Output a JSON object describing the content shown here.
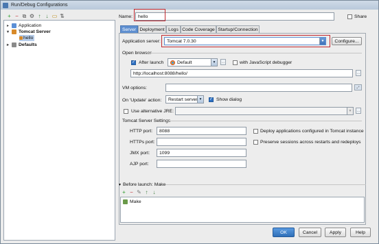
{
  "window": {
    "title": "Run/Debug Configurations"
  },
  "toolbar": {
    "icons": [
      "add-icon",
      "remove-icon",
      "copy-icon",
      "settings-icon",
      "move-up-icon",
      "move-down-icon",
      "folder-icon",
      "sort-icon"
    ]
  },
  "tree": {
    "items": [
      {
        "label": "Application"
      },
      {
        "label": "Tomcat Server"
      },
      {
        "label": "hello"
      },
      {
        "label": "Defaults"
      }
    ]
  },
  "name_field": {
    "label": "Name:",
    "value": "hello"
  },
  "share": {
    "label": "Share"
  },
  "tabs": [
    {
      "label": "Server"
    },
    {
      "label": "Deployment"
    },
    {
      "label": "Logs"
    },
    {
      "label": "Code Coverage"
    },
    {
      "label": "Startup/Connection"
    }
  ],
  "app_server": {
    "label": "Application server:",
    "value": "Tomcat 7.0.30",
    "configure": "Configure..."
  },
  "open_browser": {
    "title": "Open browser",
    "after_launch_label": "After launch",
    "browser_value": "Default",
    "js_debugger_label": "with JavaScript debugger",
    "url": "http://localhost:8088/hello/"
  },
  "vm_options": {
    "label": "VM options:",
    "value": ""
  },
  "on_update": {
    "label": "On 'Update' action:",
    "value": "Restart server",
    "show_dialog_label": "Show dialog"
  },
  "alt_jre": {
    "label": "Use alternative JRE:",
    "value": ""
  },
  "tomcat_settings": {
    "title": "Tomcat Server Settings",
    "http_port_label": "HTTP port:",
    "http_port": "8088",
    "https_port_label": "HTTPs port:",
    "https_port": "",
    "jmx_port_label": "JMX port:",
    "jmx_port": "1099",
    "ajp_port_label": "AJP port:",
    "ajp_port": "",
    "deploy_label": "Deploy applications configured in Tomcat instance",
    "preserve_label": "Preserve sessions across restarts and redeploys"
  },
  "before_launch": {
    "title": "Before launch: Make",
    "items": [
      {
        "label": "Make"
      }
    ]
  },
  "buttons": {
    "ok": "OK",
    "cancel": "Cancel",
    "apply": "Apply",
    "help": "Help"
  },
  "colors": {
    "accent": "#5f8fd0",
    "highlight": "#c0282f"
  }
}
